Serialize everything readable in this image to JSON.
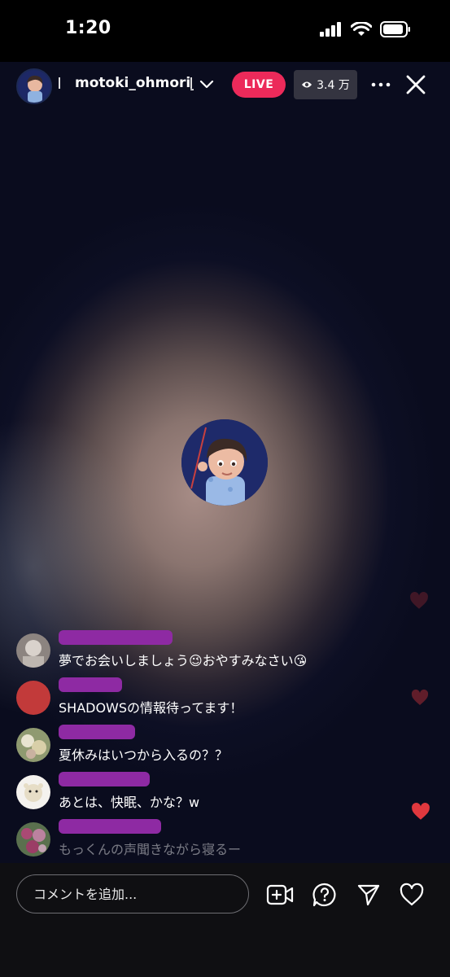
{
  "status_bar": {
    "time": "1:20",
    "icons": [
      "signal-icon",
      "wifi-icon",
      "battery-icon"
    ]
  },
  "header": {
    "host_name": "motoki_ohmori_",
    "live_label": "LIVE",
    "viewers": "3.4 万"
  },
  "comments": [
    {
      "text": "夢でお会いしましょう😉おやすみなさい😘",
      "avatar_color": "#b9b2ad"
    },
    {
      "text": "SHADOWSの情報待ってます！",
      "avatar_color": "#c23a3a"
    },
    {
      "text": "夏休みはいつから入るの？？",
      "avatar_color": "#a8b08a"
    },
    {
      "text": "あとは、快眠、かな？w",
      "avatar_color": "#e9e6e0"
    },
    {
      "text": "もっくんの声聞きながら寝るー",
      "avatar_color": "#b57a9a"
    }
  ],
  "composer": {
    "placeholder": "コメントを追加..."
  },
  "colors": {
    "live_badge": "#ec2a5a",
    "username_redaction": "#8e2aa3",
    "heart": "#e0383e"
  }
}
